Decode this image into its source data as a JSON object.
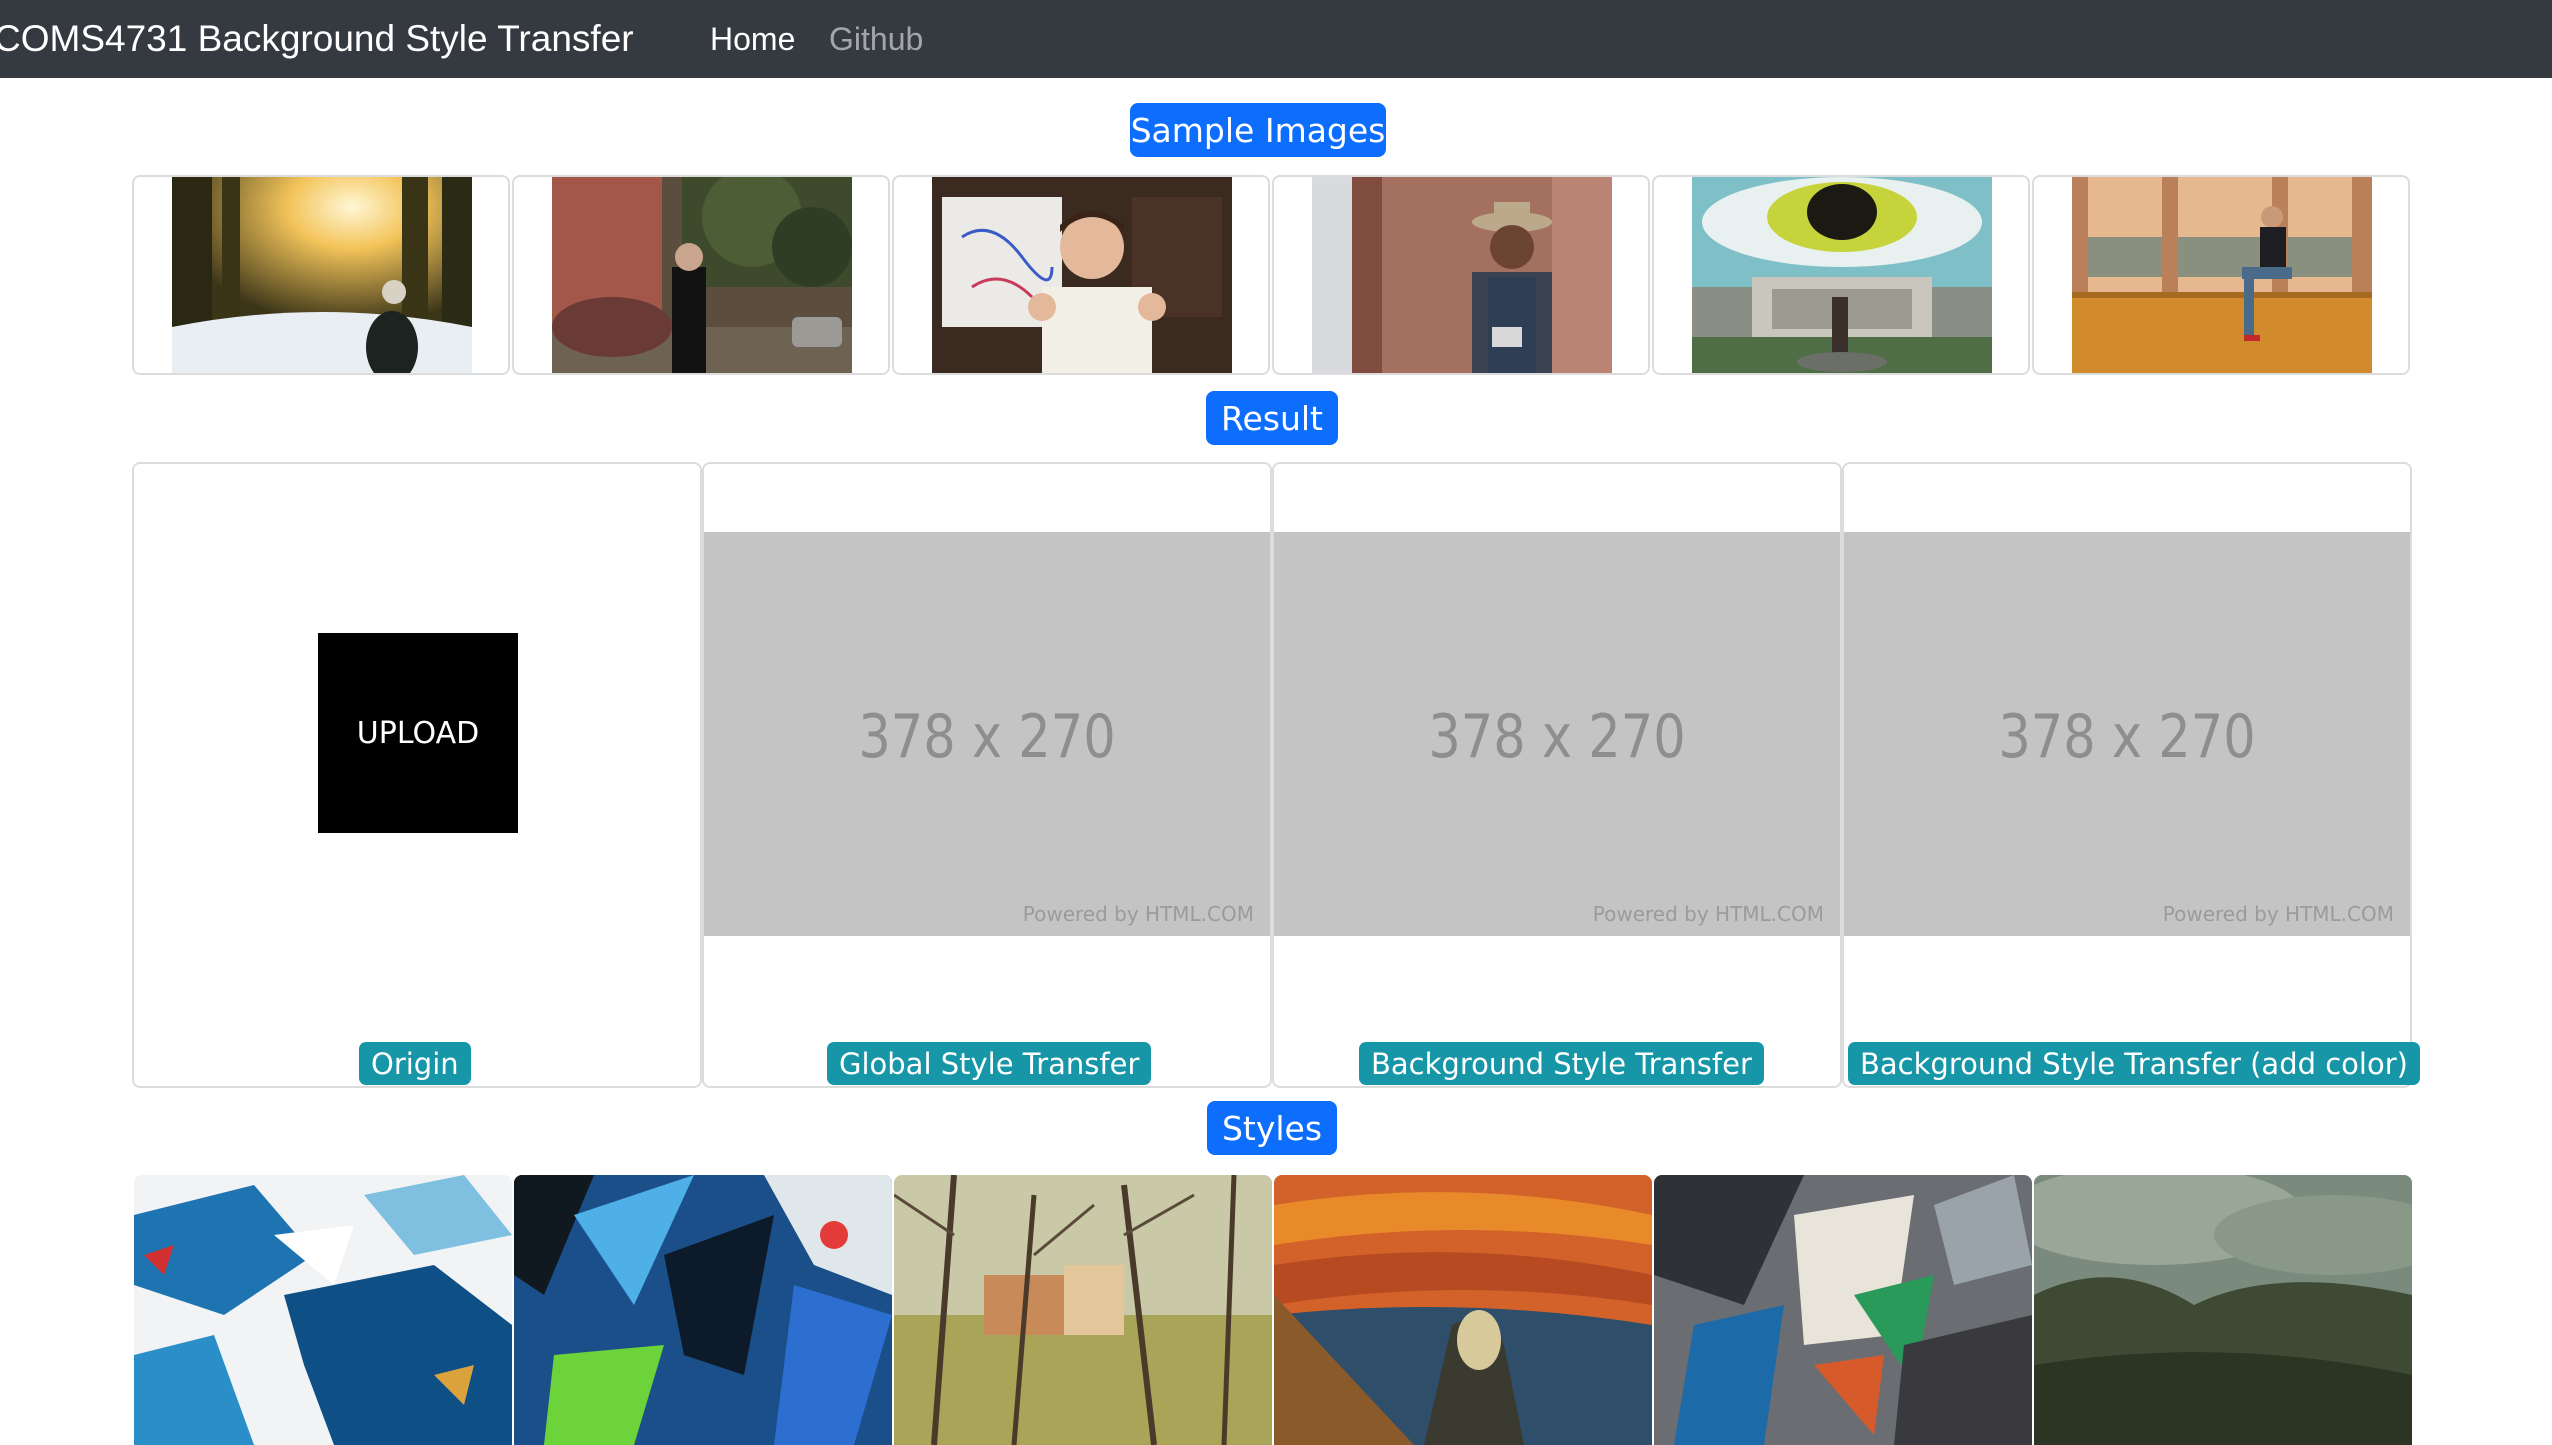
{
  "navbar": {
    "brand": "COMS4731 Background Style Transfer",
    "links": [
      "Home",
      "Github"
    ]
  },
  "sections": {
    "samples": "Sample Images",
    "result": "Result",
    "styles": "Styles"
  },
  "result": {
    "upload_label": "UPLOAD",
    "placeholder_size": "378 x 270",
    "placeholder_powered": "Powered by HTML.COM",
    "labels": [
      "Origin",
      "Global Style Transfer",
      "Background Style Transfer",
      "Background Style Transfer (add color)"
    ]
  },
  "colors": {
    "navbar": "#343a40",
    "badge_primary": "#0d6efd",
    "badge_info": "#1796a8"
  }
}
